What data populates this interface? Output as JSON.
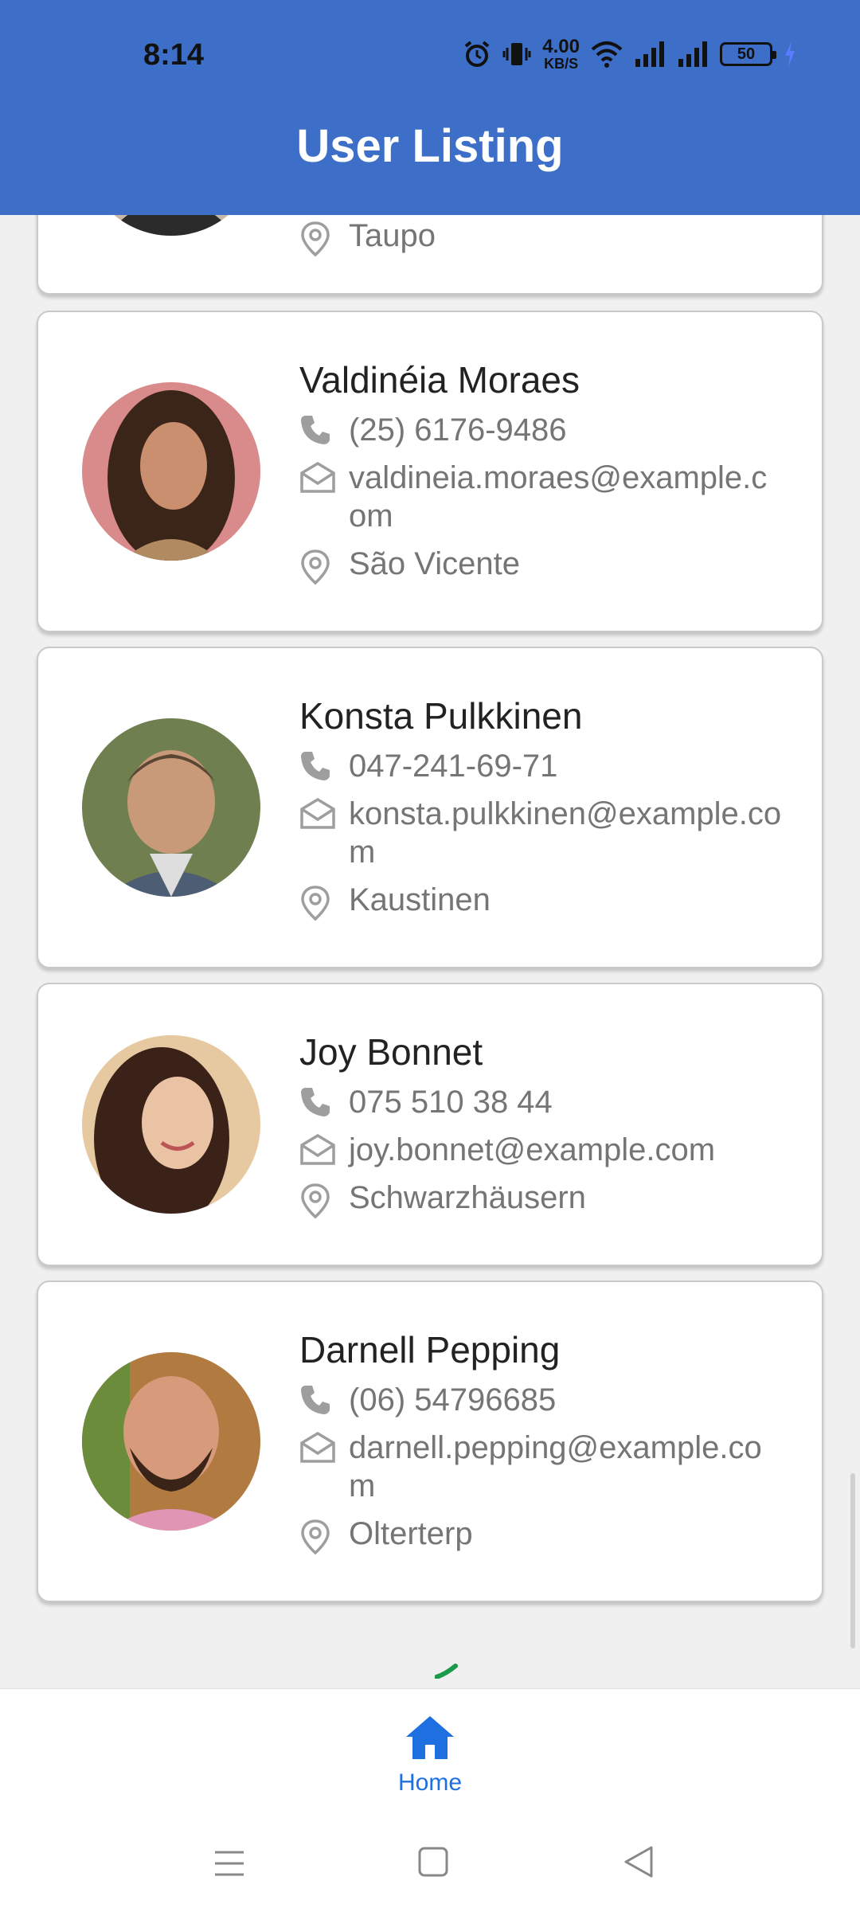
{
  "status_bar": {
    "time": "8:14",
    "net_speed_value": "4.00",
    "net_speed_unit": "KB/S",
    "battery": "50"
  },
  "header": {
    "title": "User Listing"
  },
  "users": [
    {
      "name": "",
      "phone": "",
      "email": "",
      "location": "Taupo"
    },
    {
      "name": "Valdinéia Moraes",
      "phone": "(25) 6176-9486",
      "email": "valdineia.moraes@example.com",
      "location": "São Vicente"
    },
    {
      "name": "Konsta Pulkkinen",
      "phone": "047-241-69-71",
      "email": "konsta.pulkkinen@example.com",
      "location": "Kaustinen"
    },
    {
      "name": "Joy Bonnet",
      "phone": "075 510 38 44",
      "email": "joy.bonnet@example.com",
      "location": "Schwarzhäusern"
    },
    {
      "name": "Darnell Pepping",
      "phone": "(06) 54796685",
      "email": "darnell.pepping@example.com",
      "location": "Olterterp"
    }
  ],
  "bottom_nav": {
    "home_label": "Home"
  },
  "colors": {
    "appbar": "#3d6fc8",
    "accent": "#1e6fe0",
    "spinner": "#1a9b4a"
  },
  "icons": [
    "phone-icon",
    "mail-icon",
    "location-pin-icon",
    "home-icon"
  ]
}
